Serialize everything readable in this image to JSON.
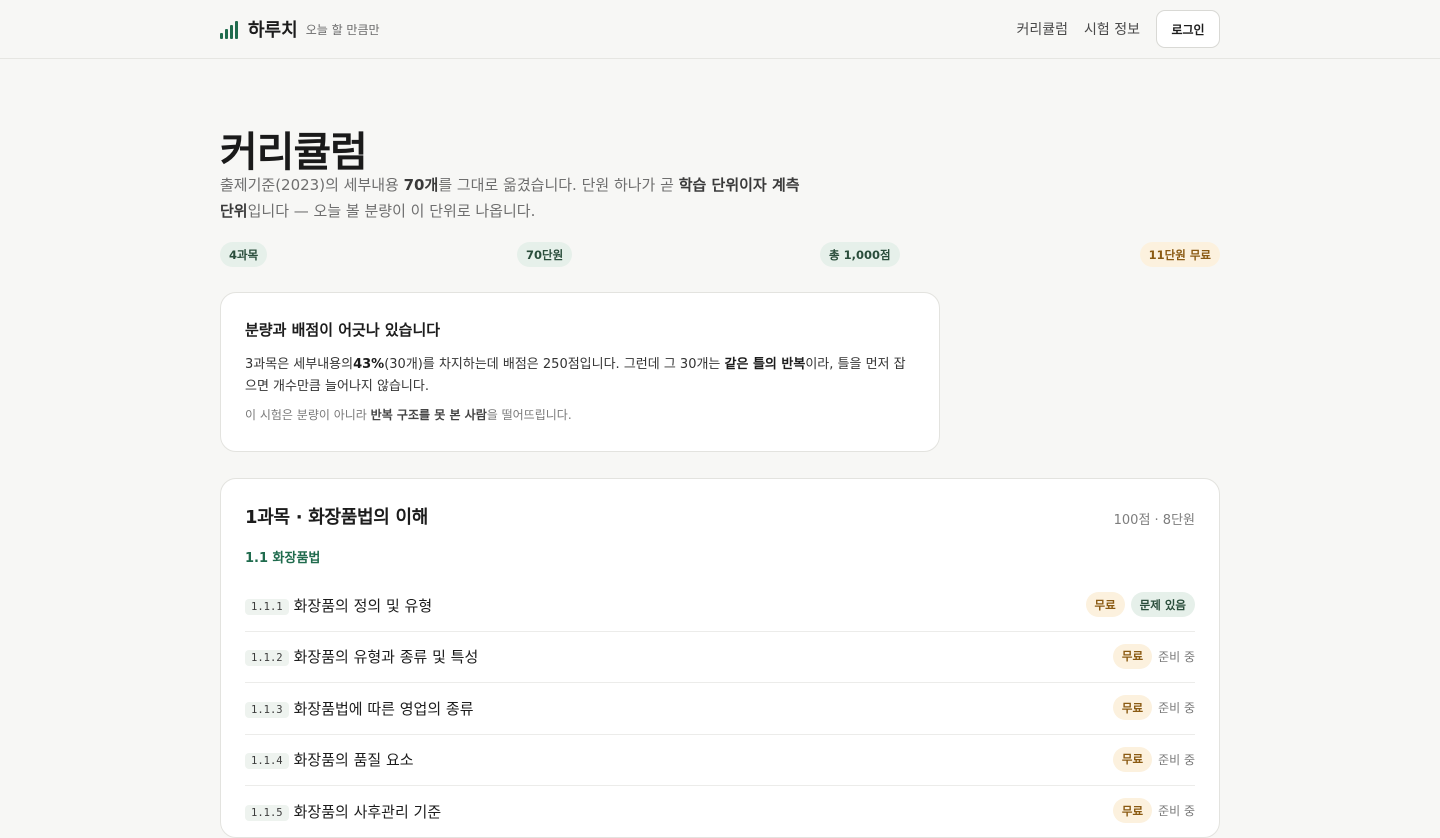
{
  "header": {
    "brand_name": "하루치",
    "brand_tagline": "오늘 할 만큼만",
    "nav": [
      "커리큘럼",
      "시험 정보"
    ],
    "login_label": "로그인"
  },
  "page": {
    "title": "커리큘럼",
    "intro_1": "출제기준(2023)의 세부내용 ",
    "intro_2": "70개",
    "intro_3": "를 그대로 옮겼습니다. 단원 하나가 곧 ",
    "intro_4": "학습 단위이자 계측 단위",
    "intro_5": "입니다 — 오늘 볼 분량이 이 단위로 나옵니다."
  },
  "stats": {
    "subjects": "4과목",
    "units": "70단원",
    "total_points": "총 1,000점",
    "free_units": "11단원 무료"
  },
  "note": {
    "title": "분량과 배점이 어긋나 있습니다",
    "body_1": "3과목은 세부내용의",
    "body_2": "43%",
    "body_3": "(30개)를 차지하는데 배점은 250점입니다. 그런데 그 30개는 ",
    "body_4": "같은 틀의 반복",
    "body_5": "이라, 틀을 먼저 잡으면 개수만큼 늘어나지 않습니다.",
    "sub_1": "이 시험은 분량이 아니라 ",
    "sub_2": "반복 구조를 못 본 사람",
    "sub_3": "을 떨어뜨립니다."
  },
  "subject": {
    "title": "1과목 · 화장품법의 이해",
    "meta": "100점 · 8단원",
    "section": "1.1 화장품법",
    "units": [
      {
        "code": "1.1.1",
        "title": "화장품의 정의 및 유형",
        "free": "무료",
        "status": "문제 있음"
      },
      {
        "code": "1.1.2",
        "title": "화장품의 유형과 종류 및 특성",
        "free": "무료",
        "status": "준비 중"
      },
      {
        "code": "1.1.3",
        "title": "화장품법에 따른 영업의 종류",
        "free": "무료",
        "status": "준비 중"
      },
      {
        "code": "1.1.4",
        "title": "화장품의 품질 요소",
        "free": "무료",
        "status": "준비 중"
      },
      {
        "code": "1.1.5",
        "title": "화장품의 사후관리 기준",
        "free": "무료",
        "status": "준비 중"
      }
    ]
  },
  "colors": {
    "accent": "#1f6b4d",
    "background": "#f7f7f5",
    "free_tag_bg": "#fcf1de",
    "green_pill_bg": "#e6f0ea"
  },
  "icons": {
    "brand": "bar-chart-icon"
  }
}
